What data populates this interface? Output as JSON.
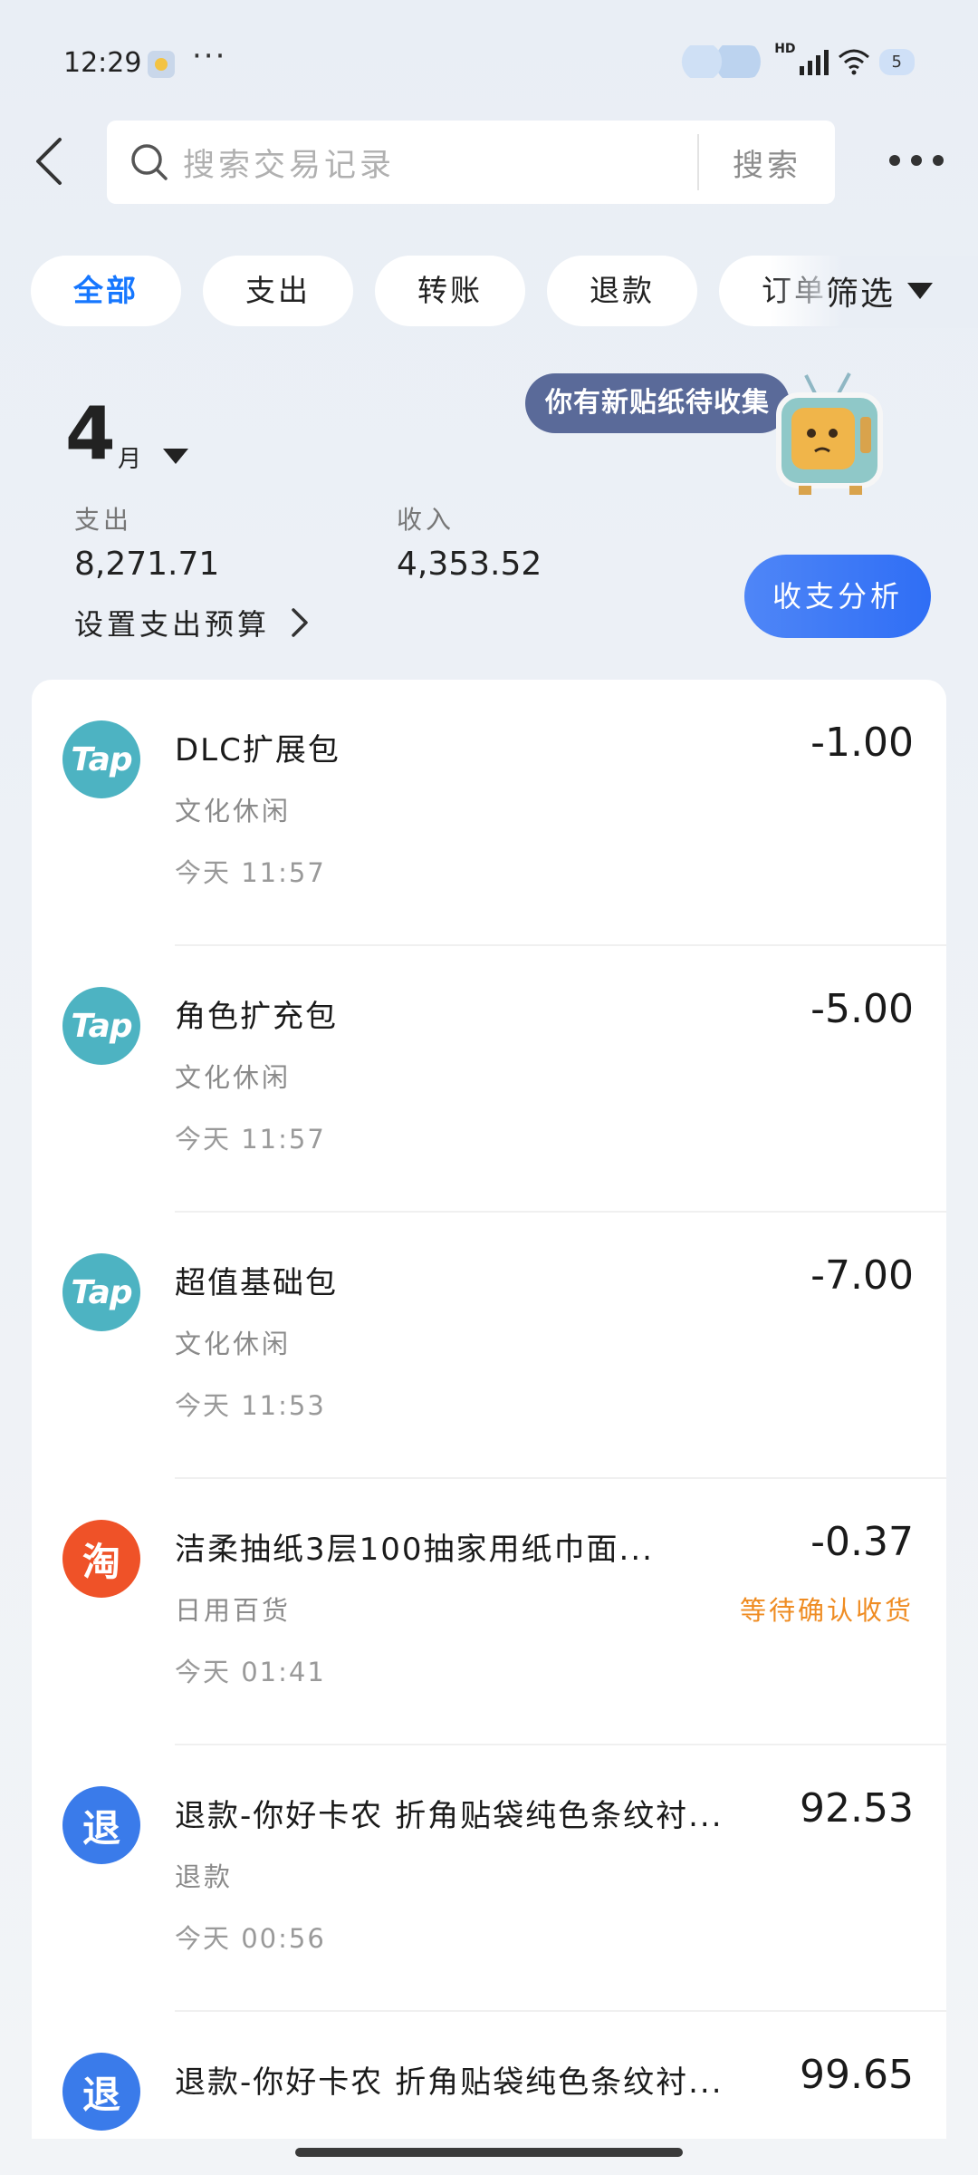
{
  "status_bar": {
    "time": "12:29",
    "dots": "···",
    "hd": "HD",
    "battery": "5"
  },
  "search": {
    "placeholder": "搜索交易记录",
    "button": "搜索"
  },
  "filters": {
    "chips": [
      "全部",
      "支出",
      "转账",
      "退款",
      "订单"
    ],
    "active_index": 0,
    "filter_label": "筛选"
  },
  "summary": {
    "month_number": "4",
    "month_unit": "月",
    "expense_label": "支出",
    "expense_value": "8,271.71",
    "income_label": "收入",
    "income_value": "4,353.52",
    "budget_label": "设置支出预算",
    "sticker_text": "你有新贴纸待收集",
    "analysis_button": "收支分析"
  },
  "transactions": [
    {
      "icon": "Tap",
      "icon_type": "tap",
      "title": "DLC扩展包",
      "category": "文化休闲",
      "time": "今天 11:57",
      "amount": "-1.00",
      "status": ""
    },
    {
      "icon": "Tap",
      "icon_type": "tap",
      "title": "角色扩充包",
      "category": "文化休闲",
      "time": "今天 11:57",
      "amount": "-5.00",
      "status": ""
    },
    {
      "icon": "Tap",
      "icon_type": "tap",
      "title": "超值基础包",
      "category": "文化休闲",
      "time": "今天 11:53",
      "amount": "-7.00",
      "status": ""
    },
    {
      "icon": "淘",
      "icon_type": "tao",
      "title": "洁柔抽纸3层100抽家用纸巾面...",
      "category": "日用百货",
      "time": "今天 01:41",
      "amount": "-0.37",
      "status": "等待确认收货"
    },
    {
      "icon": "退",
      "icon_type": "ref",
      "title": "退款-你好卡农 折角贴袋纯色条纹衬...",
      "category": "退款",
      "time": "今天 00:56",
      "amount": "92.53",
      "status": ""
    },
    {
      "icon": "退",
      "icon_type": "ref",
      "title": "退款-你好卡农 折角贴袋纯色条纹衬...",
      "category": "",
      "time": "",
      "amount": "99.65",
      "status": ""
    }
  ],
  "colors": {
    "accent": "#1677ff",
    "pending": "#ef8c22",
    "tap": "#4db3c2",
    "taobao": "#ef5228",
    "refund": "#3a7bea"
  }
}
